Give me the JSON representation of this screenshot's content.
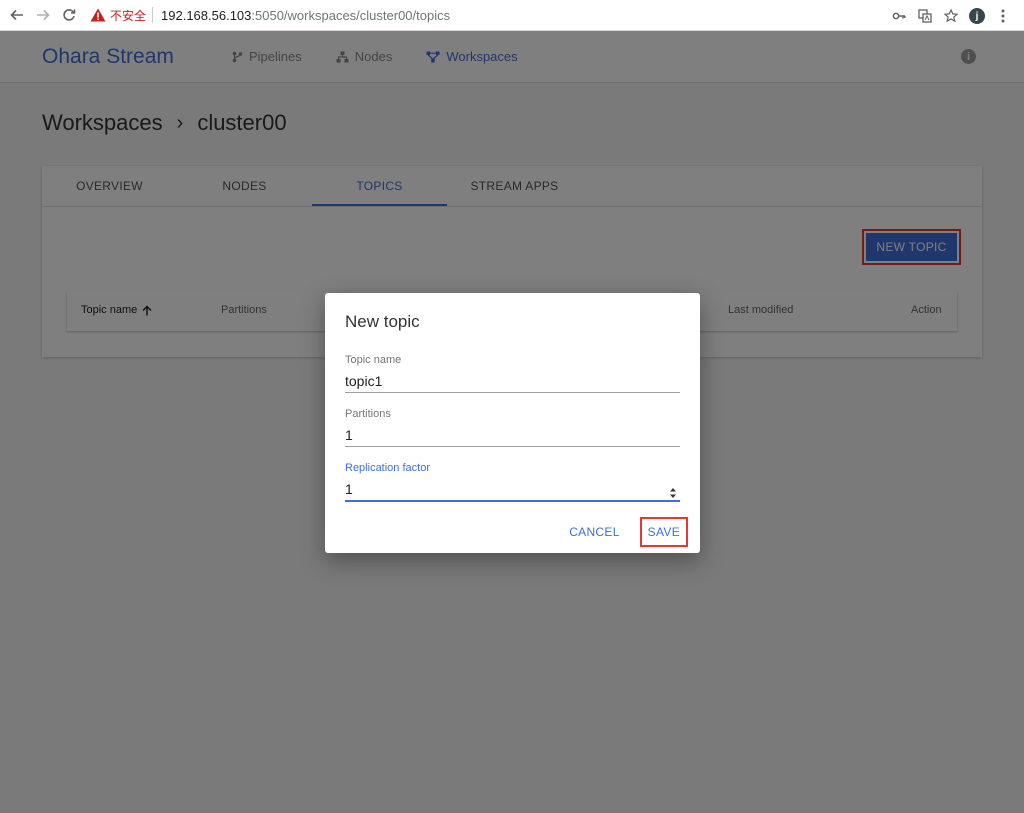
{
  "browser": {
    "insecure_label": "不安全",
    "url_host": "192.168.56.103",
    "url_path": ":5050/workspaces/cluster00/topics",
    "profile_initial": "j"
  },
  "header": {
    "brand": "Ohara Stream",
    "nav": [
      {
        "label": "Pipelines",
        "icon": "pipeline-icon"
      },
      {
        "label": "Nodes",
        "icon": "nodes-icon"
      },
      {
        "label": "Workspaces",
        "icon": "workspaces-icon",
        "active": true
      }
    ]
  },
  "breadcrumb": {
    "root": "Workspaces",
    "separator": "›",
    "current": "cluster00"
  },
  "tabs": [
    "OVERVIEW",
    "NODES",
    "TOPICS",
    "STREAM APPS"
  ],
  "active_tab": "TOPICS",
  "new_topic_label": "NEW TOPIC",
  "table": {
    "columns": [
      "Topic name",
      "Partitions",
      "Last modified",
      "Action"
    ]
  },
  "dialog": {
    "title": "New topic",
    "fields": [
      {
        "label": "Topic name",
        "value": "topic1"
      },
      {
        "label": "Partitions",
        "value": "1"
      },
      {
        "label": "Replication factor",
        "value": "1"
      }
    ],
    "cancel_label": "CANCEL",
    "save_label": "SAVE"
  },
  "colors": {
    "accent": "#3f6fd8",
    "highlight_border": "#e53935"
  }
}
